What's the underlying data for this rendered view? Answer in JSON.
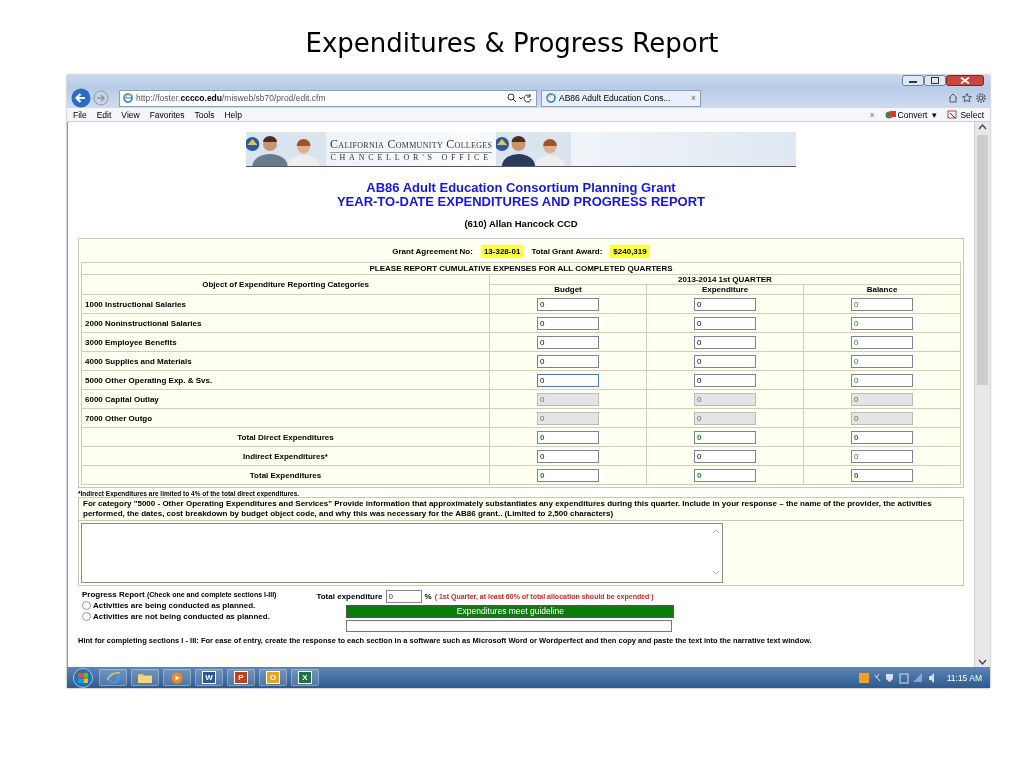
{
  "slide_title": "Expenditures & Progress Report",
  "browser": {
    "address_prefix": "http://foster.",
    "address_host": "cccco.edu",
    "address_path": "/misweb/sb70/prod/edit.cfm",
    "tab_title": "AB86 Adult Education Cons...",
    "tab_close": "×",
    "menu": [
      "File",
      "Edit",
      "View",
      "Favorites",
      "Tools",
      "Help"
    ],
    "toolbar_close": "×",
    "toolbar": [
      "Convert",
      "Select"
    ],
    "convert_caret": "▾"
  },
  "page": {
    "banner": {
      "line1": "California Community Colleges",
      "line2": "CHANCELLOR'S OFFICE"
    },
    "title": "AB86 Adult Education Consortium Planning Grant",
    "subtitle": "YEAR-TO-DATE EXPENDITURES AND PROGRESS REPORT",
    "org": "(610)  Allan Hancock CCD",
    "grant_label": "Grant Agreement No:",
    "grant_no": "13-328-01",
    "award_label": "Total Grant Award:",
    "award": "$240,319",
    "table": {
      "caption": "PLEASE REPORT CUMULATIVE EXPENSES FOR ALL COMPLETED QUARTERS",
      "category_header": "Object of Expenditure Reporting Categories",
      "period_header": "2013-2014 1st QUARTER",
      "columns": [
        {
          "label": "Budget",
          "computed": false
        },
        {
          "label": "Expenditure",
          "computed": false
        },
        {
          "label": "Balance",
          "computed": true
        }
      ],
      "rows": [
        {
          "category": "1000 Instructional Salaries",
          "kind": "item",
          "disabled": false,
          "cells": [
            {
              "value": "0",
              "focused": false
            },
            {
              "value": "0",
              "focused": false
            },
            {
              "value": "0",
              "focused": false
            }
          ]
        },
        {
          "category": "2000 Noninstructional Salaries",
          "kind": "item",
          "disabled": false,
          "cells": [
            {
              "value": "0",
              "focused": false
            },
            {
              "value": "0",
              "focused": false
            },
            {
              "value": "0",
              "focused": false
            }
          ]
        },
        {
          "category": "3000 Employee Benefits",
          "kind": "item",
          "disabled": false,
          "cells": [
            {
              "value": "0",
              "focused": false
            },
            {
              "value": "0",
              "focused": false
            },
            {
              "value": "0",
              "focused": false
            }
          ]
        },
        {
          "category": "4000 Supplies and Materials",
          "kind": "item",
          "disabled": false,
          "cells": [
            {
              "value": "0",
              "focused": false
            },
            {
              "value": "0",
              "focused": false
            },
            {
              "value": "0",
              "focused": false
            }
          ]
        },
        {
          "category": "5000 Other Operating Exp. & Svs.",
          "kind": "item",
          "disabled": false,
          "cells": [
            {
              "value": "0",
              "focused": true
            },
            {
              "value": "0",
              "focused": false
            },
            {
              "value": "0",
              "focused": false
            }
          ]
        },
        {
          "category": "6000 Capital Outlay",
          "kind": "item",
          "disabled": true,
          "cells": [
            {
              "value": "0",
              "focused": false
            },
            {
              "value": "0",
              "focused": false
            },
            {
              "value": "0",
              "focused": false
            }
          ]
        },
        {
          "category": "7000 Other Outgo",
          "kind": "item",
          "disabled": true,
          "cells": [
            {
              "value": "0",
              "focused": false
            },
            {
              "value": "0",
              "focused": false
            },
            {
              "value": "0",
              "focused": false
            }
          ]
        },
        {
          "category": "Total Direct Expenditures",
          "kind": "total",
          "disabled": false,
          "cells": [
            {
              "value": "0",
              "focused": false
            },
            {
              "value": "0",
              "focused": false
            },
            {
              "value": "0",
              "focused": false
            }
          ]
        },
        {
          "category": "Indirect Expenditures*",
          "kind": "entry",
          "disabled": false,
          "cells": [
            {
              "value": "0",
              "focused": false
            },
            {
              "value": "0",
              "focused": false
            },
            {
              "value": "0",
              "focused": false
            }
          ]
        },
        {
          "category": "Total Expenditures",
          "kind": "total",
          "disabled": false,
          "cells": [
            {
              "value": "0",
              "focused": false
            },
            {
              "value": "0",
              "focused": false
            },
            {
              "value": "0",
              "focused": false
            }
          ]
        }
      ]
    },
    "footnote": "*Indirect Expenditures are limited to 4% of the total direct expenditures.",
    "narrative_prompt": "For category \"5000 - Other Operating Expenditures and Services\" Provide information that approximately substantiates any expenditures during this quarter. Include in your response – the name of the provider, the activities performed, the dates, cost breakdown by budget object code, and why this was necessary for the AB86 grant.. (Limited to 2,500 characters)",
    "progress": {
      "label": "Progress Report",
      "instruction": "(Check one and complete sections I-III)",
      "options": [
        {
          "label": "Activities are being conducted as planned.",
          "selected": false
        },
        {
          "label": "Activities are not being conducted as planned.",
          "selected": false
        }
      ],
      "total_label": "Total expenditure",
      "total_value": "0",
      "percent": "%",
      "guideline_note": "( 1st Quarter, at least 60% of total allocation should be expended )",
      "status": "Expenditures meet guideline"
    },
    "hint": "Hint for completing sections I - III: For ease of entry, create the response to each section in a software such as Microsoft Word or Wordperfect and then copy and paste the text into the narrative text window."
  },
  "taskbar": {
    "apps": [
      {
        "kind": "browser"
      },
      {
        "kind": "folder"
      },
      {
        "kind": "media"
      },
      {
        "kind": "doc",
        "letter": "W",
        "color": "#2b5797"
      },
      {
        "kind": "doc",
        "letter": "P",
        "color": "#c43e1c"
      },
      {
        "kind": "doc",
        "letter": "O",
        "color": "#e8a317"
      },
      {
        "kind": "doc",
        "letter": "X",
        "color": "#1e7145"
      }
    ],
    "time": "11:15 AM"
  }
}
